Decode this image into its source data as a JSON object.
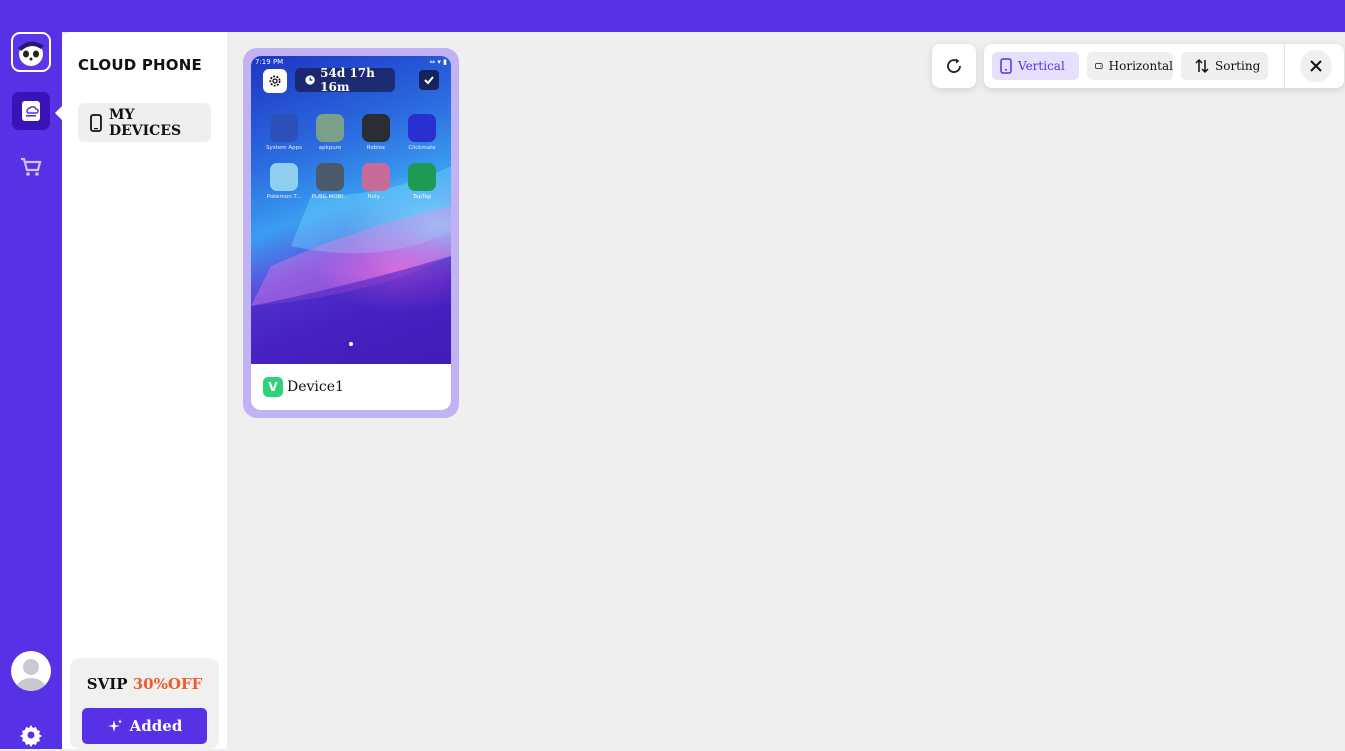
{
  "sidebar": {
    "icons": [
      "panda-logo-icon",
      "cloud-phone-icon",
      "cart-icon",
      "avatar-icon",
      "gear-icon"
    ]
  },
  "panel": {
    "title": "CLOUD PHONE",
    "my_devices_label": "MY DEVICES",
    "promo_prefix": "SVIP ",
    "promo_discount": "30%OFF",
    "added_label": "Added"
  },
  "toolbar": {
    "vertical_label": "Vertical",
    "horizontal_label": "Horizontal",
    "sorting_label": "Sorting",
    "selected": "Vertical"
  },
  "device": {
    "status_time": "7:19 PM",
    "timer": "54d 17h 16m",
    "name": "Device1",
    "badge": "V",
    "apps": [
      {
        "label": "System Apps",
        "color": "#2c4fb8"
      },
      {
        "label": "apkpure",
        "color": "#7aa08a"
      },
      {
        "label": "Roblox",
        "color": "#2a2d33"
      },
      {
        "label": "Clickmate",
        "color": "#2a2fd0"
      },
      {
        "label": "Pokémon T...",
        "color": "#8fd0f0"
      },
      {
        "label": "PUBG MOBI...",
        "color": "#4b5a6a"
      },
      {
        "label": "Roly...",
        "color": "#c86a9a"
      },
      {
        "label": "TapTap",
        "color": "#1f9a55"
      }
    ]
  },
  "colors": {
    "brand": "#5631e6",
    "accent_off": "#f15a2b",
    "badge_green": "#2fd27a"
  }
}
